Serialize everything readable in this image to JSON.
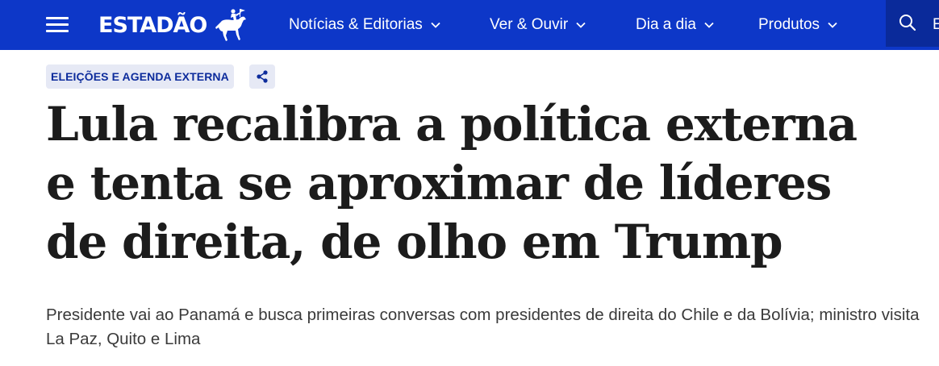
{
  "header": {
    "logo_text": "ESTADÃO",
    "nav": [
      {
        "label": "Notícias & Editorias"
      },
      {
        "label": "Ver & Ouvir"
      },
      {
        "label": "Dia a dia"
      },
      {
        "label": "Produtos"
      }
    ],
    "search_peek": "E"
  },
  "article": {
    "section_tag": "ELEIÇÕES E AGENDA EXTERNA",
    "headline": "Lula recalibra a política externa e tenta se aproximar de líderes de direita, de olho em Trump",
    "subtitle": "Presidente vai ao Panamá e busca primeiras conversas com presidentes de direita do Chile e da Bolívia; ministro visita La Paz, Quito e Lima"
  },
  "colors": {
    "header_bg": "#0d37c8",
    "search_bg": "#0a2a9a",
    "tag_bg": "#e6e9f5",
    "tag_text": "#0d2c9c",
    "headline": "#1c1c1c"
  },
  "icons": [
    "menu-icon",
    "horse-rider-logo-icon",
    "chevron-down-icon",
    "search-icon",
    "share-icon"
  ]
}
